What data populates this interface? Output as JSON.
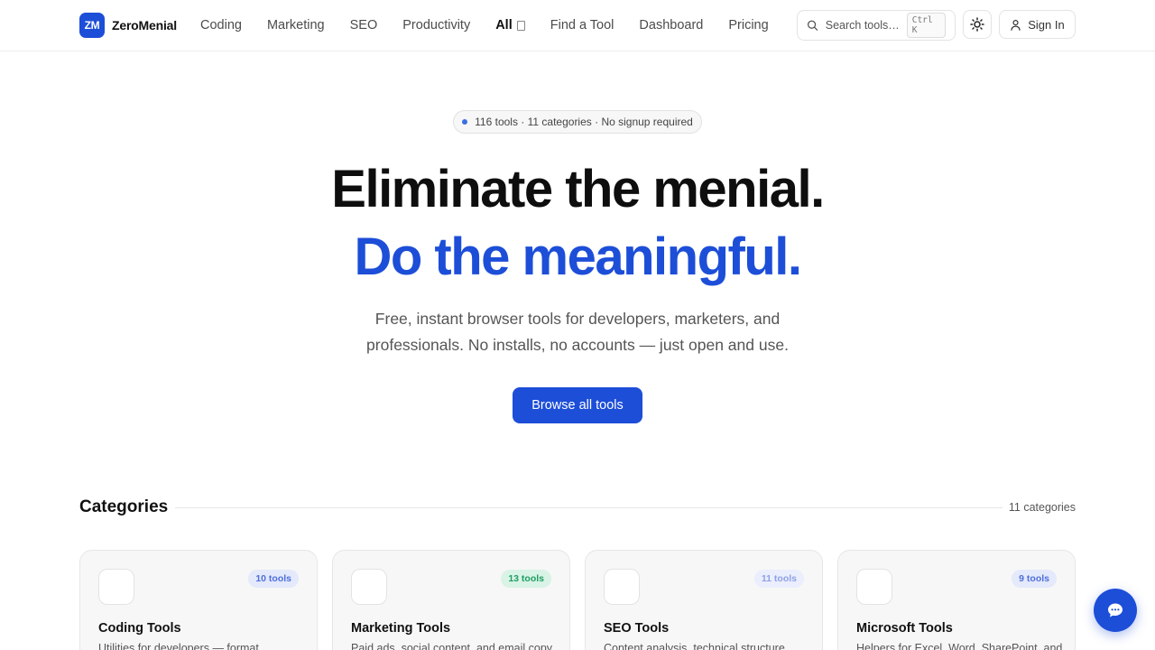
{
  "brand": {
    "mark": "ZM",
    "name": "ZeroMenial"
  },
  "nav": {
    "coding": "Coding",
    "marketing": "Marketing",
    "seo": "SEO",
    "productivity": "Productivity",
    "all": "All",
    "find": "Find a Tool",
    "dashboard": "Dashboard",
    "pricing": "Pricing"
  },
  "search": {
    "label": "Search tools…",
    "shortcut": "Ctrl K"
  },
  "auth": {
    "signin": "Sign In"
  },
  "hero": {
    "pill": "116 tools · 11 categories · No signup required",
    "line1": "Eliminate the menial.",
    "line2": "Do the meaningful.",
    "subtitle": "Free, instant browser tools for developers, marketers, and professionals. No installs, no accounts — just open and use.",
    "cta": "Browse all tools"
  },
  "categories": {
    "title": "Categories",
    "count": "11 categories",
    "cards": [
      {
        "title": "Coding Tools",
        "badge": "10 tools",
        "badge_bg": "#e4e9fb",
        "badge_fg": "#4f6fdc",
        "desc": "Utilities for developers — format,"
      },
      {
        "title": "Marketing Tools",
        "badge": "13 tools",
        "badge_bg": "#d9f3e6",
        "badge_fg": "#1f9d62",
        "desc": "Paid ads, social content, and email copy"
      },
      {
        "title": "SEO Tools",
        "badge": "11 tools",
        "badge_bg": "#ebeefc",
        "badge_fg": "#8ea1e6",
        "desc": "Content analysis, technical structure,"
      },
      {
        "title": "Microsoft Tools",
        "badge": "9 tools",
        "badge_bg": "#e4e9fb",
        "badge_fg": "#4f6fdc",
        "desc": "Helpers for Excel, Word, SharePoint, and"
      }
    ]
  },
  "colors": {
    "accent": "#1d4ed8"
  }
}
